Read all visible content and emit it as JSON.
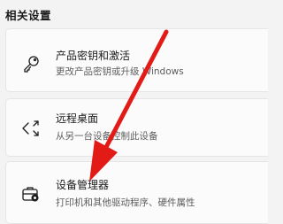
{
  "section": {
    "title": "相关设置"
  },
  "cards": [
    {
      "title": "产品密钥和激活",
      "subtitle": "更改产品密钥或升级 Windows",
      "icon": "key-icon"
    },
    {
      "title": "远程桌面",
      "subtitle": "从另一台设备控制此设备",
      "icon": "remote-desktop-icon"
    },
    {
      "title": "设备管理器",
      "subtitle": "打印机和其他驱动程序、硬件属性",
      "icon": "device-manager-icon"
    }
  ],
  "annotation": {
    "icon": "red-arrow-icon",
    "color": "#e31b17"
  }
}
